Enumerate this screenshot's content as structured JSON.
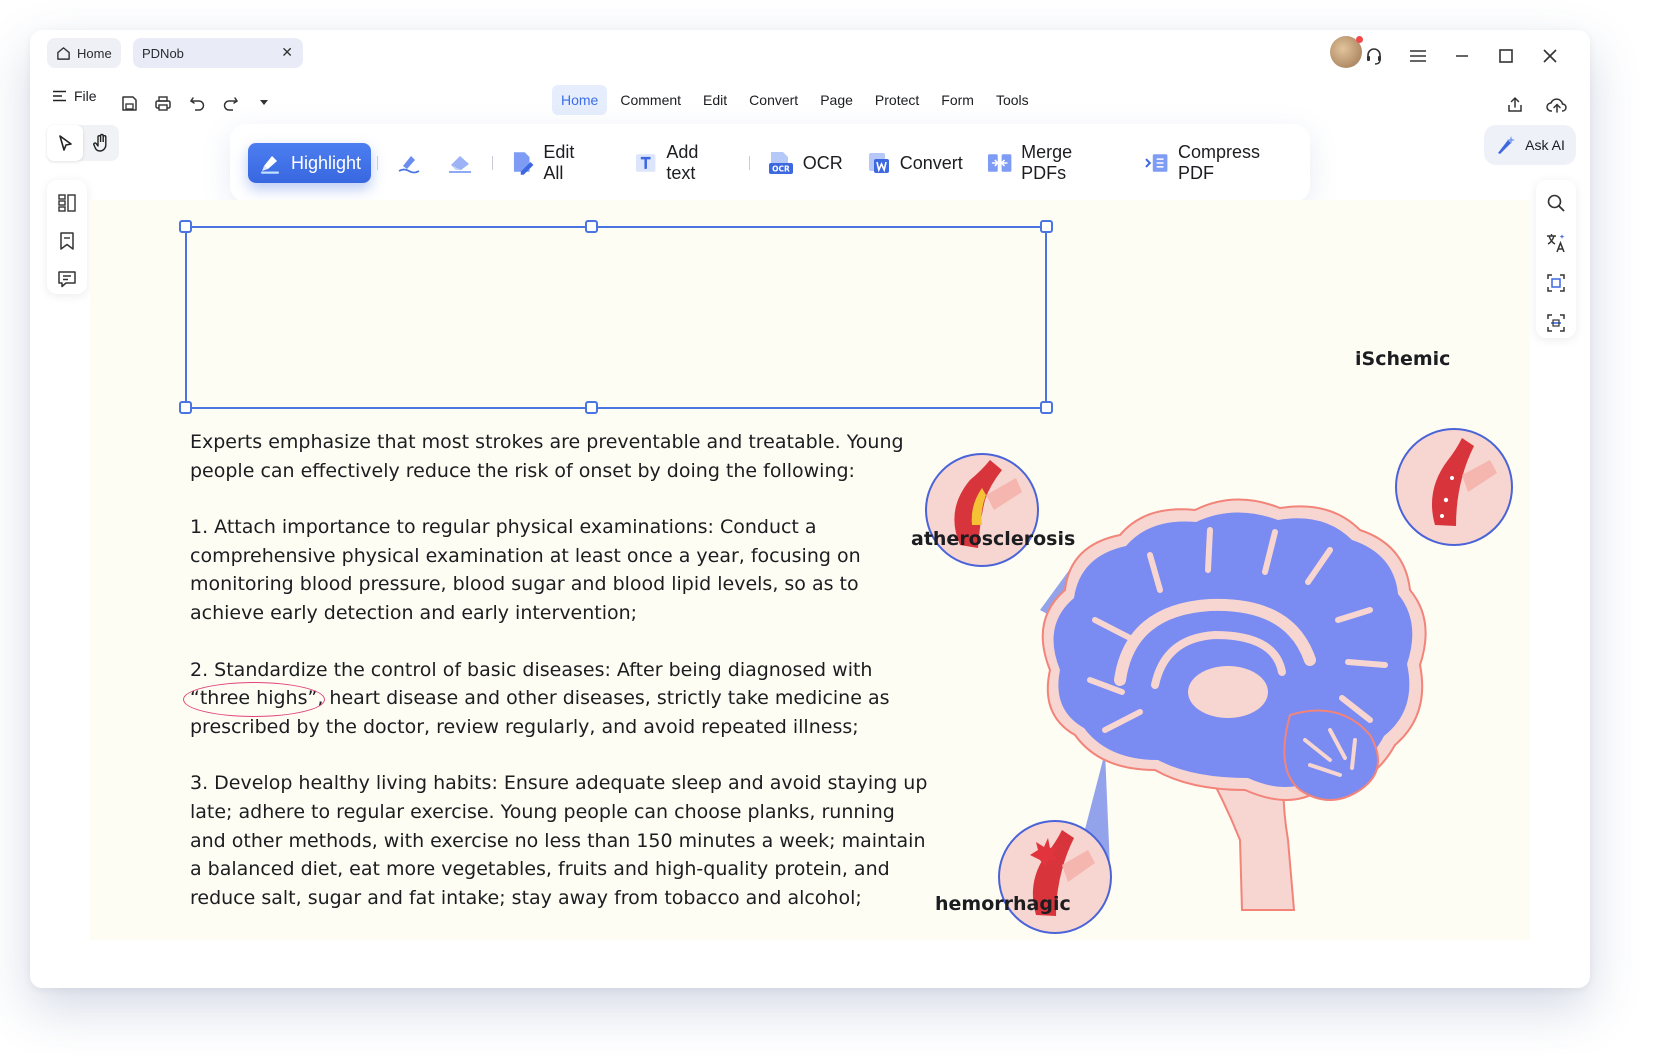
{
  "tabs": {
    "home_label": "Home",
    "doc_label": "PDNob"
  },
  "menubar": {
    "file_label": "File",
    "nav": [
      "Home",
      "Comment",
      "Edit",
      "Convert",
      "Page",
      "Protect",
      "Form",
      "Tools"
    ],
    "active_index": 0
  },
  "ribbon": {
    "highlight": "Highlight",
    "edit_all": "Edit All",
    "add_text": "Add text",
    "ocr": "OCR",
    "ocr_badge": "OCR",
    "convert": "Convert",
    "merge": "Merge PDFs",
    "compress": "Compress PDF"
  },
  "ask_ai": "Ask AI",
  "document": {
    "intro": "Experts emphasize that most strokes are preventable and treatable. Young people can effectively reduce the risk of onset by doing the following:",
    "item1": "1. Attach importance to regular physical examinations: Conduct a comprehensive physical examination at least once a year, focusing on monitoring blood pressure, blood sugar and blood lipid levels, so as to achieve early detection and early intervention;",
    "item2_pre": "2. Standardize the control of basic diseases: After being diagnosed with ",
    "item2_circled": "“three highs”",
    "item2_post": ", heart disease and other diseases, strictly take medicine as prescribed by the doctor, review regularly, and avoid repeated illness;",
    "item3": "3. Develop healthy living habits: Ensure adequate sleep and avoid staying up late; adhere to regular exercise. Young people can choose planks, running and other methods, with exercise no less than 150 minutes a week; maintain a balanced diet, eat more vegetables, fruits and high-quality protein, and reduce salt, sugar and fat intake; stay away from tobacco and alcohol;"
  },
  "figure": {
    "label_atherosclerosis": "atherosclerosis",
    "label_ischemic": "iSchemic",
    "label_hemorrhagic": "hemorrhagic"
  },
  "colors": {
    "accent": "#3b6ee8",
    "brain_fill": "#7a8bf2",
    "brain_outline": "#f2847a",
    "vessel_fill": "#f7d5d0",
    "circle_stroke": "#4a64d8",
    "page_bg": "#fdfdf3",
    "annotation_pink": "#e0457b"
  }
}
